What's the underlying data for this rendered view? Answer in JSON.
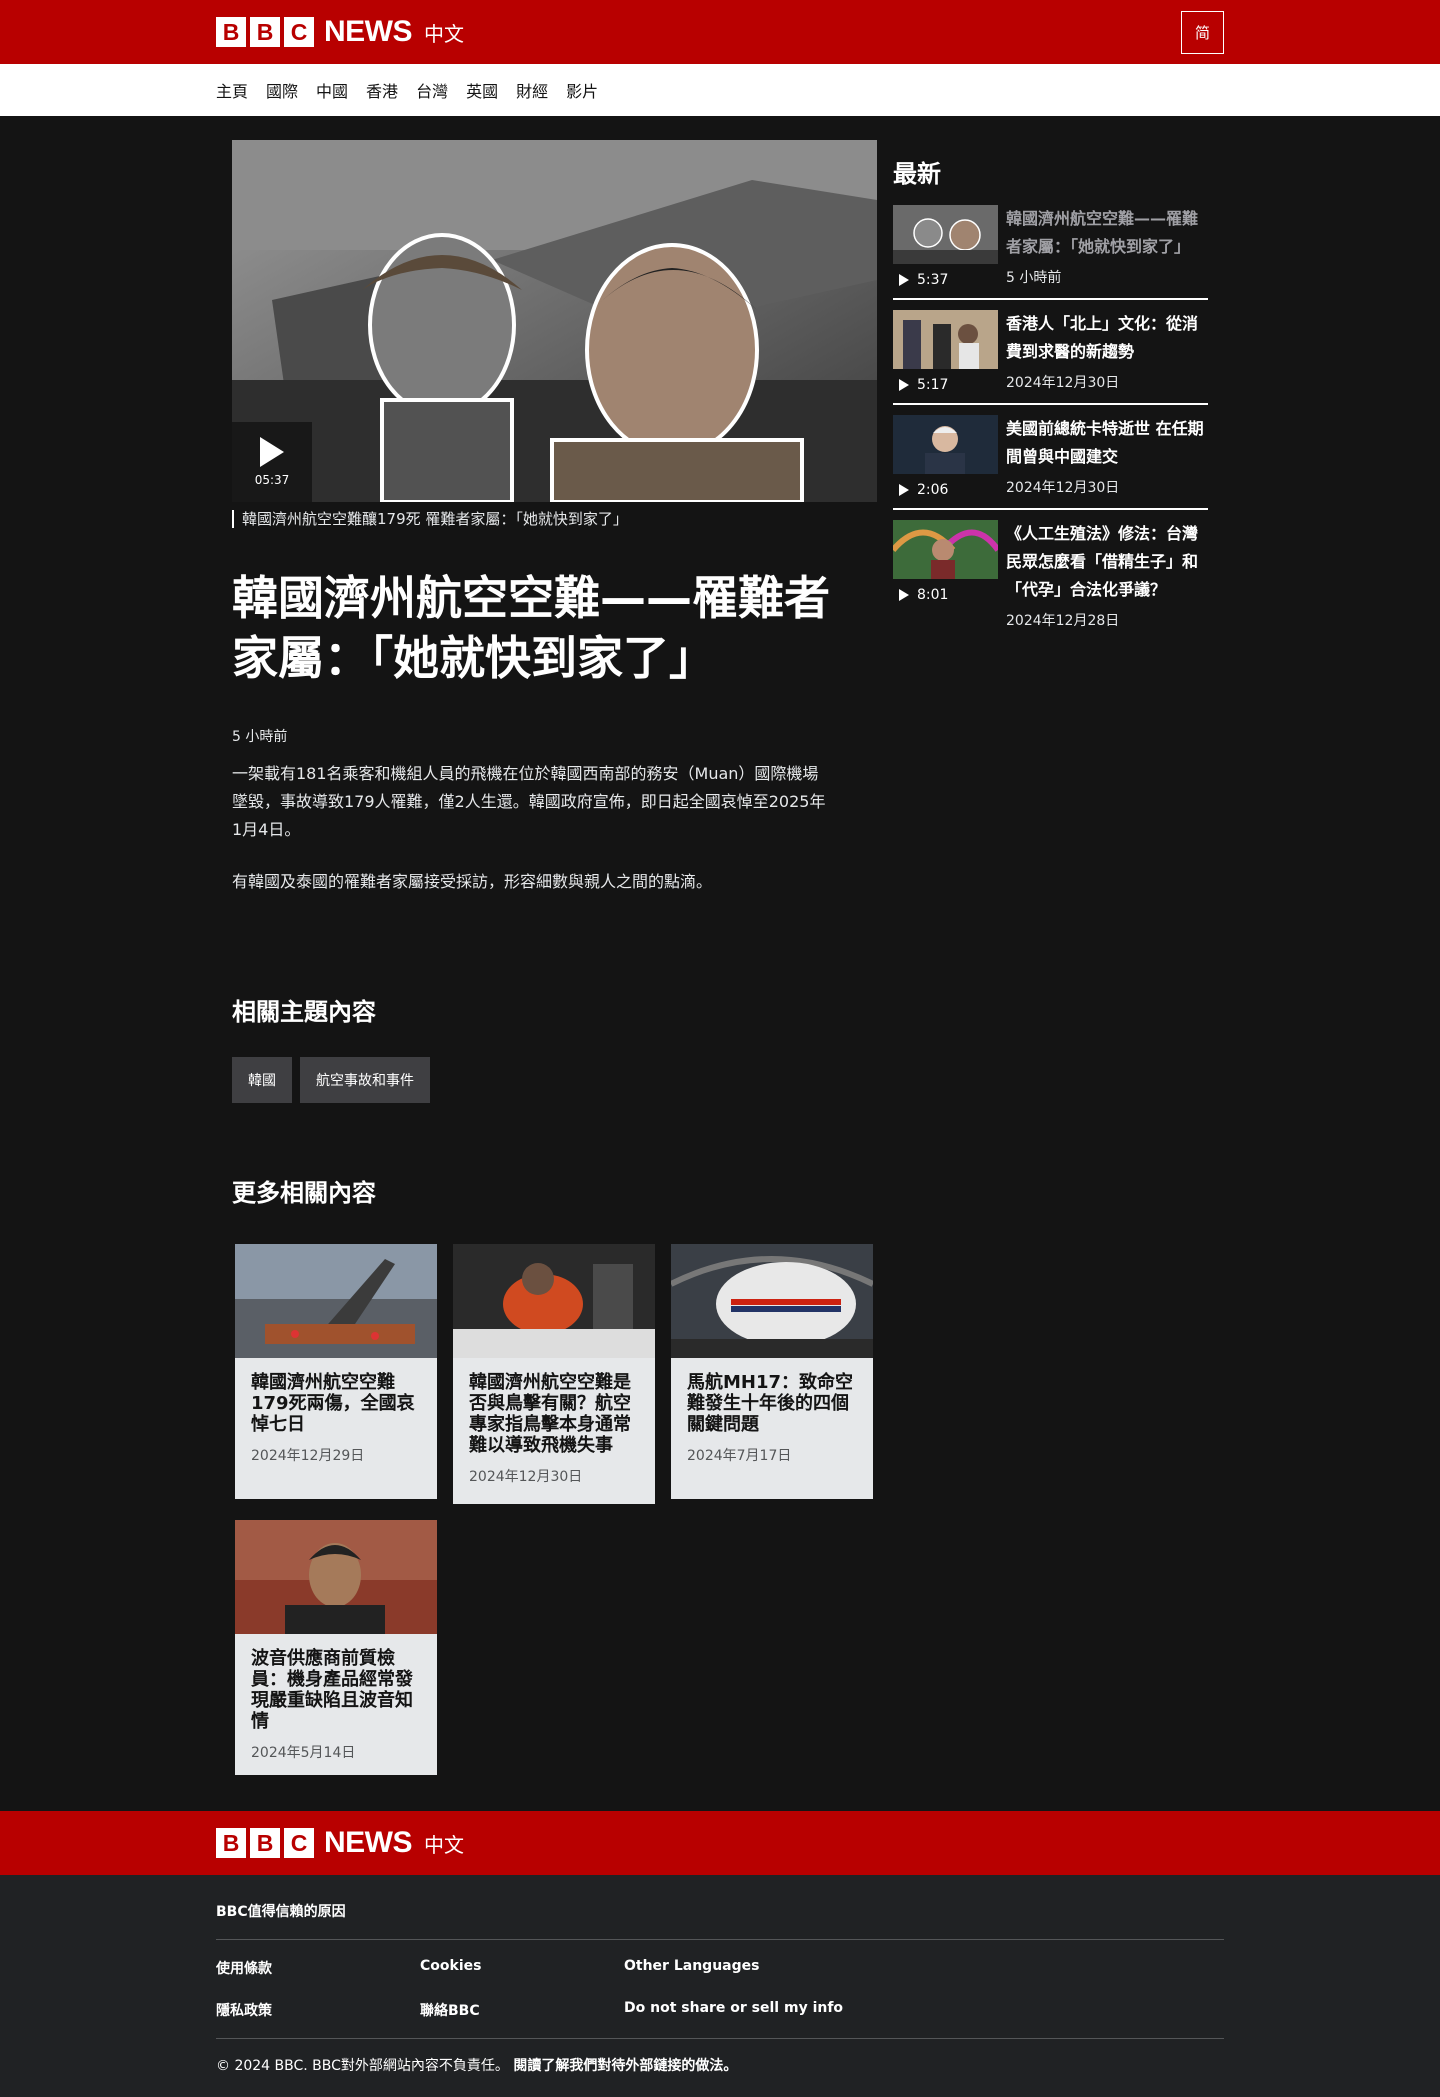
{
  "header": {
    "logo_letters": [
      "B",
      "B",
      "C"
    ],
    "news_text": "NEWS",
    "lang_text": "中文",
    "script_toggle": "简",
    "brand_color": "#b80000"
  },
  "nav": {
    "items": [
      "主頁",
      "國際",
      "中國",
      "香港",
      "台灣",
      "英國",
      "財經",
      "影片"
    ]
  },
  "article": {
    "video_duration": "05:37",
    "caption": "韓國濟州航空空難釀179死 罹難者家屬：「她就快到家了」",
    "headline": "韓國濟州航空空難——罹難者家屬：「她就快到家了」",
    "timestamp": "5 小時前",
    "paragraphs": [
      "一架載有181名乘客和機組人員的飛機在位於韓國西南部的務安（Muan）國際機場墜毀，事故導致179人罹難，僅2人生還。韓國政府宣佈，即日起全國哀悼至2025年1月4日。",
      "有韓國及泰國的罹難者家屬接受採訪，形容細數與親人之間的點滴。"
    ]
  },
  "related_topics": {
    "title": "相關主題內容",
    "tags": [
      "韓國",
      "航空事故和事件"
    ]
  },
  "more_related": {
    "title": "更多相關內容",
    "cards": [
      {
        "title": "韓國濟州航空空難179死兩傷，全國哀悼七日",
        "date": "2024年12月29日"
      },
      {
        "title": "韓國濟州航空空難是否與鳥擊有關？航空專家指鳥擊本身通常難以導致飛機失事",
        "date": "2024年12月30日"
      },
      {
        "title": "馬航MH17：致命空難發生十年後的四個關鍵問題",
        "date": "2024年7月17日"
      },
      {
        "title": "波音供應商前質檢員：機身產品經常發現嚴重缺陷且波音知情",
        "date": "2024年5月14日"
      }
    ]
  },
  "latest": {
    "title": "最新",
    "items": [
      {
        "title": "韓國濟州航空空難——罹難者家屬：「她就快到家了」",
        "duration": "5:37",
        "date": "5 小時前"
      },
      {
        "title": "香港人「北上」文化：從消費到求醫的新趨勢",
        "duration": "5:17",
        "date": "2024年12月30日"
      },
      {
        "title": "美國前總統卡特逝世 在任期間曾與中國建交",
        "duration": "2:06",
        "date": "2024年12月30日"
      },
      {
        "title": "《人工生殖法》修法：台灣民眾怎麼看「借精生子」和「代孕」合法化爭議？",
        "duration": "8:01",
        "date": "2024年12月28日"
      }
    ]
  },
  "footer": {
    "trust_link": "BBC值得信賴的原因",
    "links": [
      "使用條款",
      "Cookies",
      "Other Languages",
      "隱私政策",
      "聯絡BBC",
      "Do not share or sell my info"
    ],
    "copyright": "© 2024 BBC. BBC對外部網站內容不負責任。",
    "external_link": "閱讀了解我們對待外部鏈接的做法。"
  }
}
